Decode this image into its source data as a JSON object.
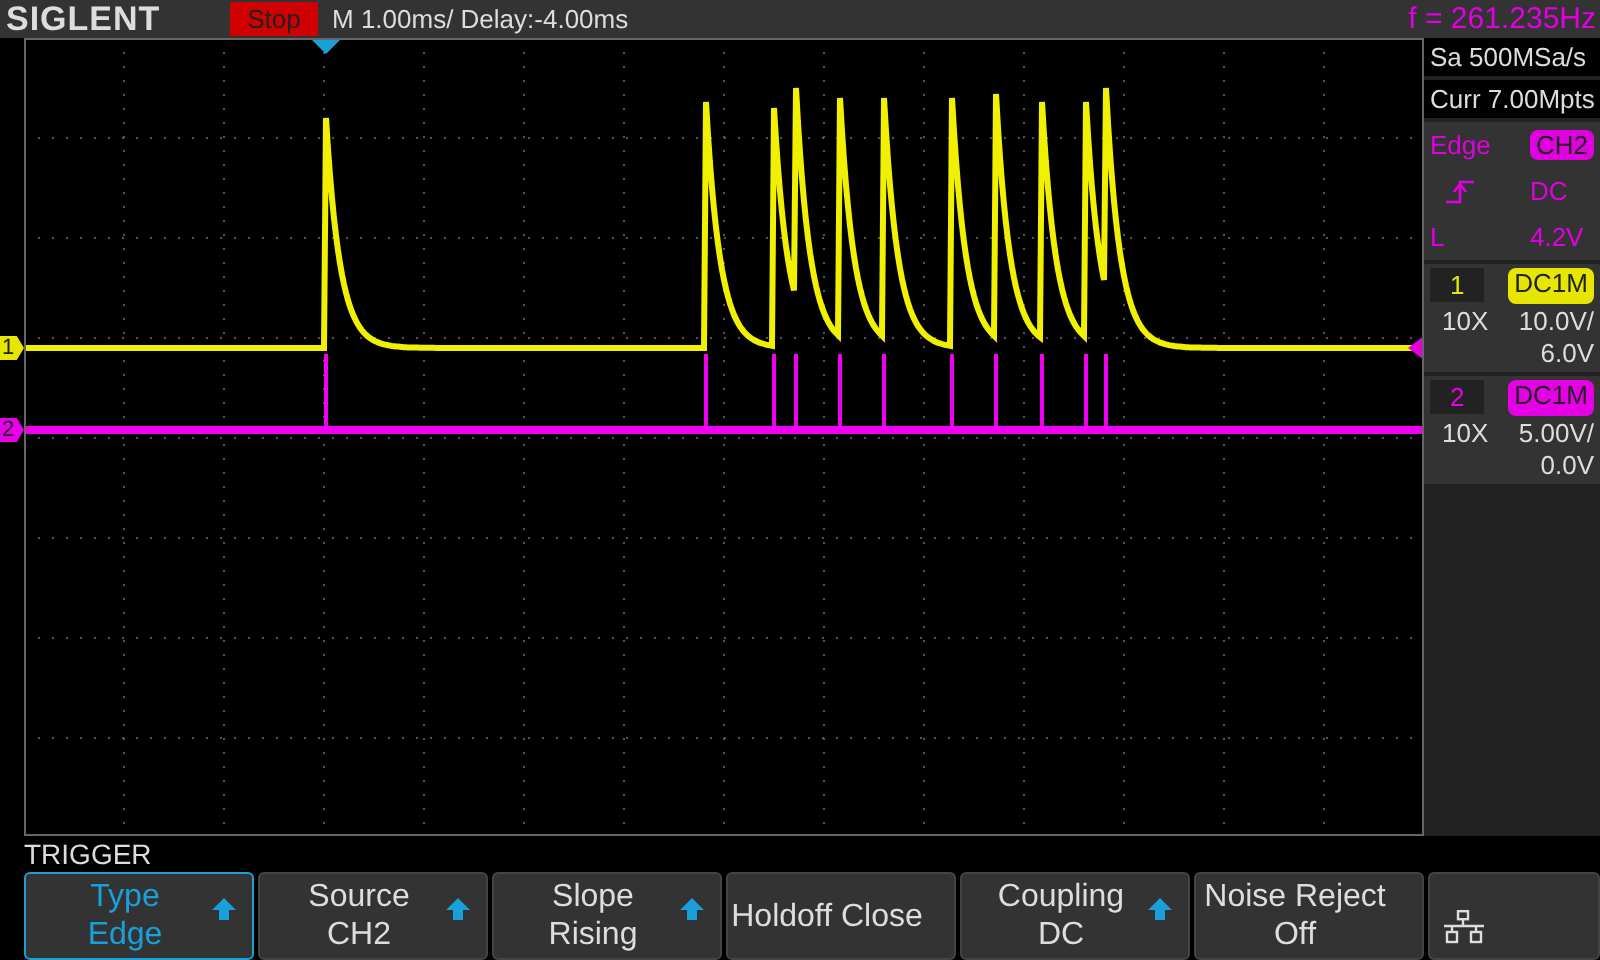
{
  "top_bar": {
    "logo": "SIGLENT",
    "run_state": "Stop",
    "timebase": "M 1.00ms/ Delay:-4.00ms",
    "frequency": "f = 261.235Hz"
  },
  "markers": [
    {
      "label": "1",
      "color": "#e6e600"
    },
    {
      "label": "2",
      "color": "#e600e6"
    }
  ],
  "acquisition": {
    "sample_rate": "Sa 500MSa/s",
    "memory": "Curr 7.00Mpts"
  },
  "trigger_info": {
    "type": "Edge",
    "source": "CH2",
    "coupling": "DC",
    "level_label": "L",
    "level": "4.2V"
  },
  "channels": [
    {
      "number": "1",
      "coupling": "DC1M",
      "probe": "10X",
      "scale": "10.0V/",
      "offset": "6.0V",
      "color": "#e6e600"
    },
    {
      "number": "2",
      "coupling": "DC1M",
      "probe": "10X",
      "scale": "5.00V/",
      "offset": "0.0V",
      "color": "#e600e6"
    }
  ],
  "menu": {
    "title": "TRIGGER",
    "softkeys": [
      {
        "kind": "option",
        "label": "Type",
        "value": "Edge",
        "selected": true,
        "arrow": true
      },
      {
        "kind": "option",
        "label": "Source",
        "value": "CH2",
        "selected": false,
        "arrow": true
      },
      {
        "kind": "option",
        "label": "Slope",
        "value": "Rising",
        "selected": false,
        "arrow": true
      },
      {
        "kind": "option",
        "label": "Holdoff Close",
        "selected": false,
        "arrow": false
      },
      {
        "kind": "option",
        "label": "Coupling",
        "value": "DC",
        "selected": false,
        "arrow": true
      },
      {
        "kind": "option",
        "label": "Noise Reject",
        "value": "Off",
        "selected": false,
        "arrow": false
      },
      {
        "kind": "network"
      }
    ]
  }
}
